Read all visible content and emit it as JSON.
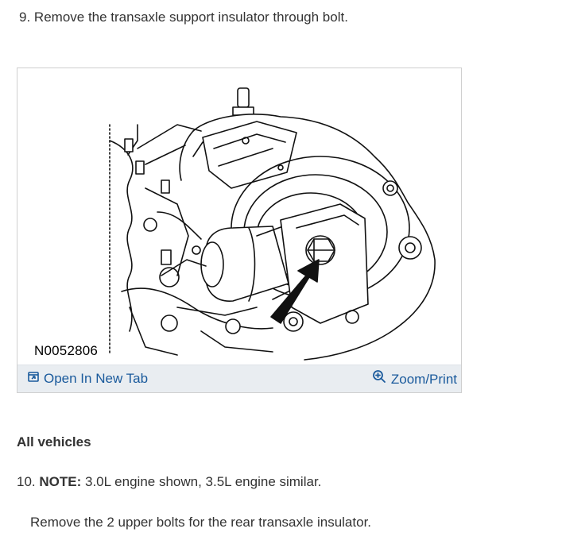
{
  "step9": {
    "number": "9.",
    "text": "Remove the transaxle support insulator through bolt."
  },
  "figure": {
    "id_label": "N0052806",
    "open_tab_label": "Open In New Tab",
    "zoom_label": "Zoom/Print",
    "open_icon": "open-in-new-tab-icon",
    "zoom_icon": "magnifier-plus-icon",
    "link_color": "#1a5a9c",
    "bar_color": "#e9edf1"
  },
  "section": {
    "heading": "All vehicles"
  },
  "step10": {
    "number": "10.",
    "note_label": "NOTE:",
    "note_text": "3.0L engine shown, 3.5L engine similar.",
    "instruction": "Remove the 2 upper bolts for the rear transaxle insulator."
  }
}
